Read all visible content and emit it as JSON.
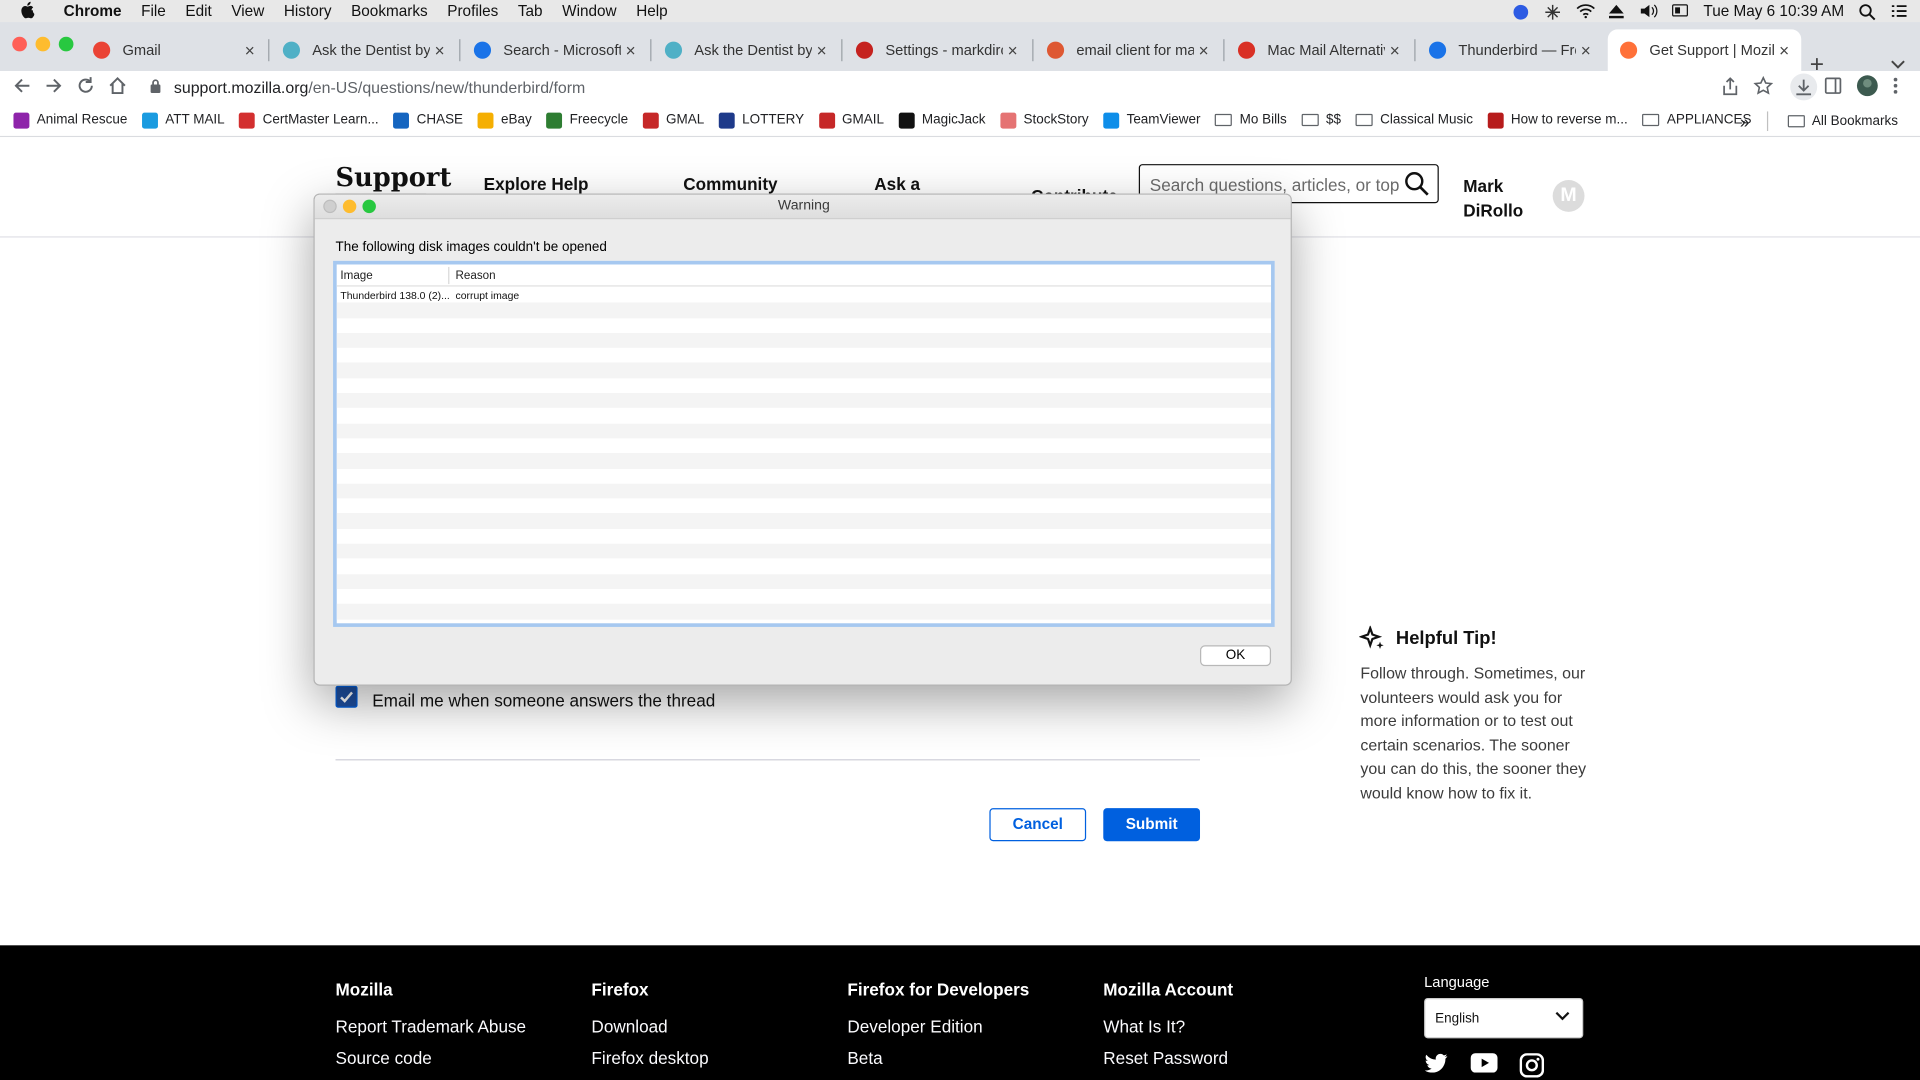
{
  "menubar": {
    "app": "Chrome",
    "items": [
      "File",
      "Edit",
      "View",
      "History",
      "Bookmarks",
      "Profiles",
      "Tab",
      "Window",
      "Help"
    ],
    "clock": "Tue May 6  10:39 AM"
  },
  "tabs": [
    {
      "title": "Gmail",
      "color": "#ea4335"
    },
    {
      "title": "Ask the Dentist by Ma",
      "color": "#4fb0c6"
    },
    {
      "title": "Search - Microsoft Bin",
      "color": "#1a73e8"
    },
    {
      "title": "Ask the Dentist by Ma",
      "color": "#4fb0c6"
    },
    {
      "title": "Settings - markdirollo",
      "color": "#c5221f"
    },
    {
      "title": "email client for mac hi",
      "color": "#de5833"
    },
    {
      "title": "Mac Mail Alternative fo",
      "color": "#d93025"
    },
    {
      "title": "Thunderbird — Free Y",
      "color": "#1a73e8"
    },
    {
      "title": "Get Support | Mozilla",
      "color": "#ff7139"
    }
  ],
  "toolbar": {
    "url_host": "support.mozilla.org",
    "url_path": "/en-US/questions/new/thunderbird/form"
  },
  "bookmarks": [
    {
      "label": "Animal Rescue",
      "color": "#8e24aa"
    },
    {
      "label": "ATT MAIL",
      "color": "#1a9be0"
    },
    {
      "label": "CertMaster Learn...",
      "color": "#d32f2f"
    },
    {
      "label": "CHASE",
      "color": "#1565c0"
    },
    {
      "label": "eBay",
      "color": "#f5af02"
    },
    {
      "label": "Freecycle",
      "color": "#2e7d32"
    },
    {
      "label": "GMAL",
      "color": "#c62828"
    },
    {
      "label": "LOTTERY",
      "color": "#1e3a8a"
    },
    {
      "label": "GMAIL",
      "color": "#c62828"
    },
    {
      "label": "MagicJack",
      "color": "#111111"
    },
    {
      "label": "StockStory",
      "color": "#e57373"
    },
    {
      "label": "TeamViewer",
      "color": "#0e8ee9"
    },
    {
      "label": "Mo Bills",
      "folder": true
    },
    {
      "label": "$$",
      "folder": true
    },
    {
      "label": "Classical Music",
      "folder": true
    },
    {
      "label": "How to reverse m...",
      "color": "#b71c1c"
    },
    {
      "label": "APPLIANCES",
      "folder": true
    }
  ],
  "bookmarks_right": {
    "more": "»",
    "all": "All Bookmarks"
  },
  "site": {
    "logo": "Support",
    "nav": [
      "Explore Help",
      "Community",
      "Ask a",
      "Contribute"
    ],
    "search_placeholder": "Search questions, articles, or top",
    "user_first": "Mark",
    "user_last": "DiRollo",
    "avatar_letter": "M"
  },
  "form": {
    "email_checkbox_label": "Email me when someone answers the thread",
    "email_checked": true,
    "cancel": "Cancel",
    "submit": "Submit"
  },
  "tip": {
    "title": "Helpful Tip!",
    "body": "Follow through. Sometimes, our volunteers would ask you for more information or to test out certain scenarios. The sooner you can do this, the sooner they would know how to fix it."
  },
  "footer": {
    "columns": [
      {
        "heading": "Mozilla",
        "links": [
          "Report Trademark Abuse",
          "Source code"
        ]
      },
      {
        "heading": "Firefox",
        "links": [
          "Download",
          "Firefox desktop"
        ]
      },
      {
        "heading": "Firefox for Developers",
        "links": [
          "Developer Edition",
          "Beta"
        ]
      },
      {
        "heading": "Mozilla Account",
        "links": [
          "What Is It?",
          "Reset Password"
        ]
      }
    ],
    "language_label": "Language",
    "language_value": "English"
  },
  "dialog": {
    "title": "Warning",
    "message": "The following disk images couldn't be opened",
    "columns": [
      "Image",
      "Reason"
    ],
    "rows": [
      {
        "image": "Thunderbird 138.0 (2)...",
        "reason": "corrupt image"
      }
    ],
    "ok": "OK"
  }
}
